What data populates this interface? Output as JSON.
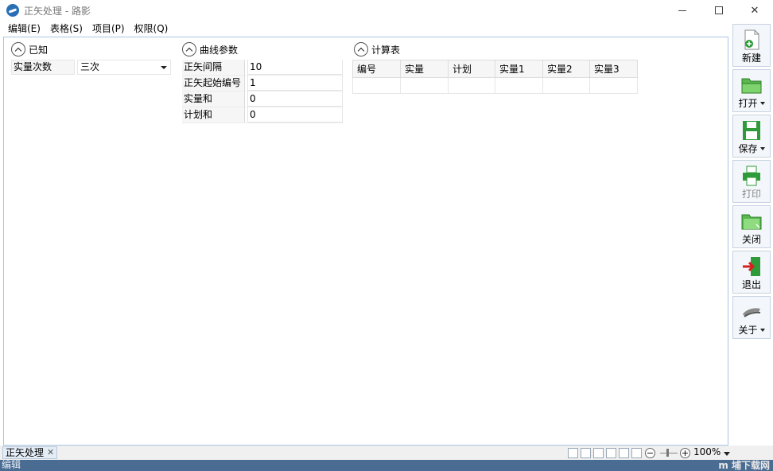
{
  "window": {
    "title": "正矢处理 - 路影",
    "minimize_label": "",
    "close_label": "✕"
  },
  "menu": [
    "编辑(E)",
    "表格(S)",
    "项目(P)",
    "权限(Q)"
  ],
  "known": {
    "header": "已知",
    "field_label": "实量次数",
    "field_value": "三次"
  },
  "curve_params": {
    "header": "曲线参数",
    "rows": [
      {
        "label": "正矢间隔",
        "value": "10"
      },
      {
        "label": "正矢起始编号",
        "value": "1"
      },
      {
        "label": "实量和",
        "value": "0"
      },
      {
        "label": "计划和",
        "value": "0"
      }
    ]
  },
  "calc_table": {
    "header": "计算表",
    "columns": [
      "编号",
      "实量",
      "计划",
      "实量1",
      "实量2",
      "实量3"
    ],
    "rows": [
      [
        "",
        "",
        "",
        "",
        "",
        ""
      ]
    ]
  },
  "toolbar": [
    {
      "name": "new",
      "label": "新建",
      "dropdown": false,
      "enabled": true,
      "icon": "new-document-icon"
    },
    {
      "name": "open",
      "label": "打开",
      "dropdown": true,
      "enabled": true,
      "icon": "folder-open-icon"
    },
    {
      "name": "save",
      "label": "保存",
      "dropdown": true,
      "enabled": true,
      "icon": "floppy-disk-icon"
    },
    {
      "name": "print",
      "label": "打印",
      "dropdown": false,
      "enabled": false,
      "icon": "printer-icon"
    },
    {
      "name": "close",
      "label": "关闭",
      "dropdown": false,
      "enabled": true,
      "icon": "folder-close-icon"
    },
    {
      "name": "exit",
      "label": "退出",
      "dropdown": false,
      "enabled": true,
      "icon": "exit-door-icon"
    },
    {
      "name": "about",
      "label": "关于",
      "dropdown": true,
      "enabled": true,
      "icon": "about-icon"
    }
  ],
  "status": {
    "doc_tab": "正矢处理",
    "doc_tab_close": "✕",
    "zoom": "100%"
  },
  "bottom": {
    "mode": "编辑",
    "watermark": "m 埔下载网"
  },
  "colors": {
    "accent_border": "#a9c4e0",
    "bottom_bar": "#4a6c93",
    "icon_green": "#2f9a3a"
  }
}
